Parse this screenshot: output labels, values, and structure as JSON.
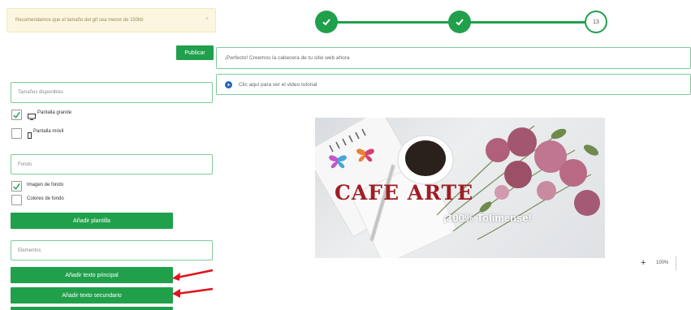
{
  "notice": {
    "text": "Recomendamos que el tamaño del gif sea menor de 150kb",
    "close": "×"
  },
  "stepper": {
    "current_step": "13"
  },
  "publish_button": "Publicar",
  "header_bar": "¡Perfecto! Creemos la cabecera de tu sitio web ahora",
  "tutorial_link": "Clic aquí para ver el video tutorial",
  "sizes": {
    "placeholder": "Tamaños disponibles",
    "large_label": "Pantalla grande",
    "large_checked": true,
    "mobile_label": "Pantalla móvil",
    "mobile_checked": false
  },
  "background": {
    "placeholder": "Fondo",
    "image_label": "Imagen de fondo",
    "image_checked": true,
    "colors_label": "Colores de fondo",
    "colors_checked": false,
    "add_template_button": "Añadir plantilla"
  },
  "elements": {
    "placeholder": "Elementos",
    "add_main_text_button": "Añadir texto principal",
    "add_secondary_text_button": "Añadir texto secundario"
  },
  "banner": {
    "title": "CAFE ARTE",
    "subtitle": "¡100% Tolimense!"
  },
  "zoom": {
    "plus": "+",
    "value": "100%"
  },
  "colors": {
    "accent": "#21a04c",
    "arrow": "#e0141e"
  }
}
